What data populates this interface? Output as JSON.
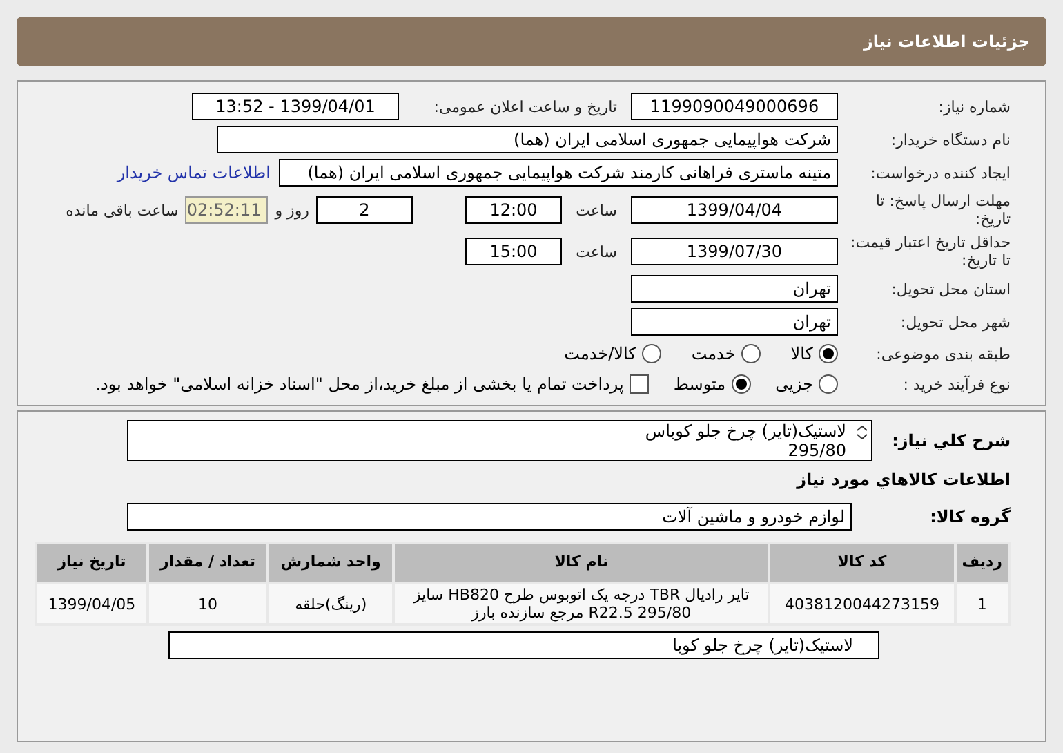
{
  "header": {
    "title": "جزئیات اطلاعات نیاز"
  },
  "details": {
    "need_number": {
      "label": "شماره نیاز:",
      "value": "1199090049000696"
    },
    "announce": {
      "label": "تاریخ و ساعت اعلان عمومی:",
      "value": "1399/04/01 - 13:52"
    },
    "buyer": {
      "label": "نام دستگاه خریدار:",
      "value": "شرکت هواپیمایی جمهوری اسلامی ایران (هما)"
    },
    "creator": {
      "label": "ایجاد کننده درخواست:",
      "value": "متینه ماستری فراهانی کارمند شرکت هواپیمایی جمهوری اسلامی ایران (هما)",
      "link": "اطلاعات تماس خریدار"
    },
    "deadline": {
      "label": "مهلت ارسال پاسخ: تا تاریخ:",
      "date": "1399/04/04",
      "time_label": "ساعت",
      "time": "12:00",
      "days": "2",
      "days_label": "روز و",
      "remaining": "02:52:11",
      "remaining_label": "ساعت باقی مانده"
    },
    "validity": {
      "label": "حداقل تاریخ اعتبار قیمت: تا تاریخ:",
      "date": "1399/07/30",
      "time_label": "ساعت",
      "time": "15:00"
    },
    "province": {
      "label": "استان محل تحویل:",
      "value": "تهران"
    },
    "city": {
      "label": "شهر محل تحویل:",
      "value": "تهران"
    },
    "category": {
      "label": "طبقه بندی موضوعی:",
      "options": [
        {
          "label": "کالا",
          "selected": true
        },
        {
          "label": "خدمت",
          "selected": false
        },
        {
          "label": "کالا/خدمت",
          "selected": false
        }
      ]
    },
    "process": {
      "label": "نوع فرآیند خرید :",
      "options": [
        {
          "label": "جزیی",
          "selected": false
        },
        {
          "label": "متوسط",
          "selected": true
        }
      ],
      "treasury": {
        "label": "پرداخت تمام یا بخشی از مبلغ خرید،از محل \"اسناد خزانه اسلامی\" خواهد بود.",
        "checked": false
      }
    }
  },
  "need": {
    "description_label": "شرح کلي نیاز:",
    "description": "لاستیک(تایر) چرخ جلو کوباس\n295/80",
    "goods_heading": "اطلاعات کالاهاي مورد نیاز",
    "group_label": "گروه کالا:",
    "group": "لوازم خودرو و ماشین آلات",
    "table": {
      "columns": [
        "ردیف",
        "کد کالا",
        "نام کالا",
        "واحد شمارش",
        "تعداد / مقدار",
        "تاریخ نیاز"
      ],
      "rows": [
        [
          "1",
          "4038120044273159",
          "تایر رادیال TBR درجه یک اتوبوس طرح HB820 سایز 295/80 R22.5 مرجع سازنده بارز",
          "(رینگ)حلقه",
          "10",
          "1399/04/05"
        ]
      ]
    },
    "extra_description": "لاستیک(تایر) چرخ جلو کوبا"
  }
}
